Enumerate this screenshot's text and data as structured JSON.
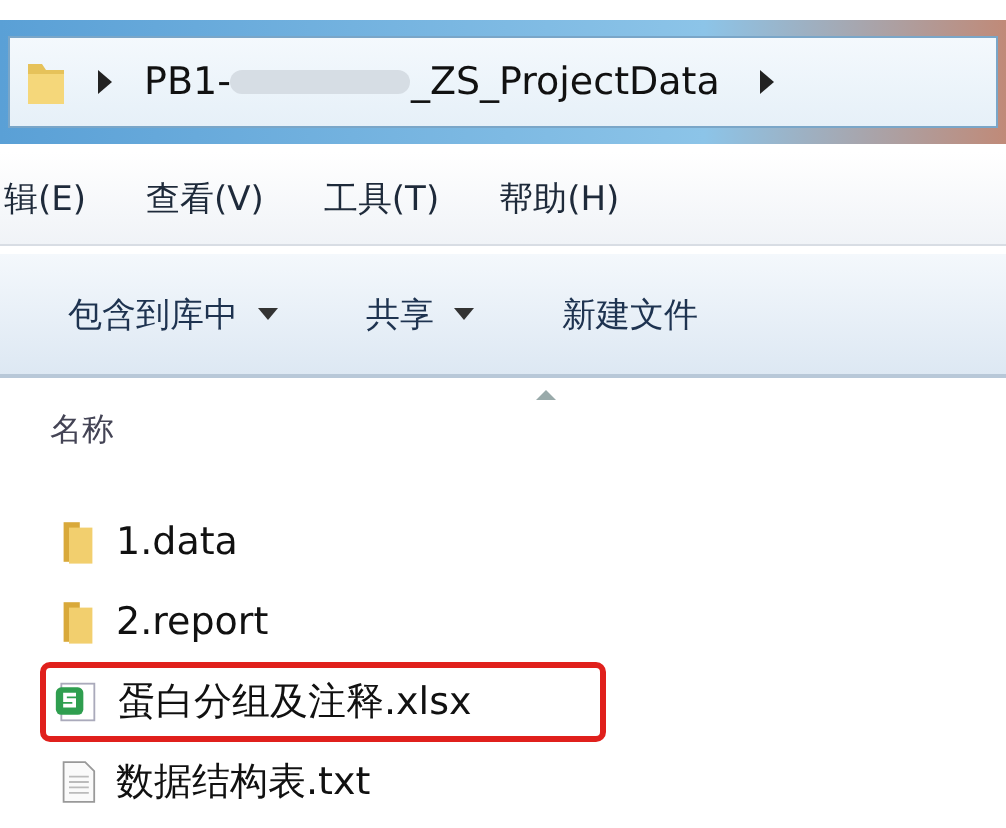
{
  "address_bar": {
    "path_start": "PB1-",
    "path_end": "_ZS_ProjectData"
  },
  "menu_bar": [
    "辑(E)",
    "查看(V)",
    "工具(T)",
    "帮助(H)"
  ],
  "toolbar": [
    {
      "label": "包含到库中",
      "dropdown": true
    },
    {
      "label": "共享",
      "dropdown": true
    },
    {
      "label": "新建文件",
      "dropdown": false
    }
  ],
  "column_header": {
    "label": "名称"
  },
  "files": [
    {
      "name": "1.data",
      "kind": "folder",
      "highlighted": false
    },
    {
      "name": "2.report",
      "kind": "folder",
      "highlighted": false
    },
    {
      "name": "蛋白分组及注释.xlsx",
      "kind": "spreadsheet",
      "highlighted": true
    },
    {
      "name": "数据结构表.txt",
      "kind": "text",
      "highlighted": false
    }
  ]
}
